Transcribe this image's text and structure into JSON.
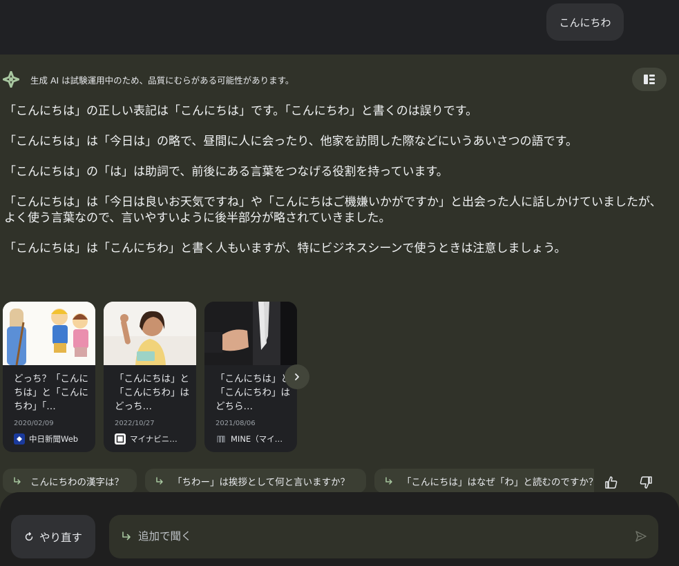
{
  "user_query": "こんにちわ",
  "generative_notice": "生成 AI は試験運用中のため、品質にむらがある可能性があります。",
  "answer_paragraphs": [
    "「こんにちは」の正しい表記は「こんにちは」です。「こんにちわ」と書くのは誤りです。",
    "「こんにちは」は「今日は」の略で、昼間に人に会ったり、他家を訪問した際などにいうあいさつの語です。",
    "「こんにちは」の「は」は助詞で、前後にある言葉をつなげる役割を持っています。",
    "「こんにちは」は「今日は良いお天気ですね」や「こんにちはご機嫌いかがですか」と出会った人に話しかけていましたが、よく使う言葉なので、言いやすいように後半部分が略されていきました。",
    "「こんにちは」は「こんにちわ」と書く人もいますが、特にビジネスシーンで使うときは注意しましょう。"
  ],
  "cards": [
    {
      "title": "どっち？「こんにちは」と「こんにちわ」「…",
      "date": "2020/02/09",
      "source": "中日新聞Web",
      "source_icon": "chunichi-icon"
    },
    {
      "title": "「こんにちは」と「こんにちわ」はどっち…",
      "date": "2022/10/27",
      "source": "マイナビニ…",
      "source_icon": "mynavi-icon"
    },
    {
      "title": "「こんにちは」と「こんにちわ」はどちら…",
      "date": "2021/08/06",
      "source": "MINE（マイ…",
      "source_icon": "mine-icon"
    }
  ],
  "related_chips": [
    "こんにちわの漢字は？",
    "「ちわー」は挨拶として何と言いますか？",
    "「こんにちは」はなぜ「わ」と読むのですか？"
  ],
  "bottom": {
    "retry_label": "やり直す",
    "followup_placeholder": "追加で聞く"
  },
  "colors": {
    "background": "#202124",
    "answer_panel": "#303229",
    "chip": "#3b3e33",
    "accent_green": "#a8c7a0"
  }
}
